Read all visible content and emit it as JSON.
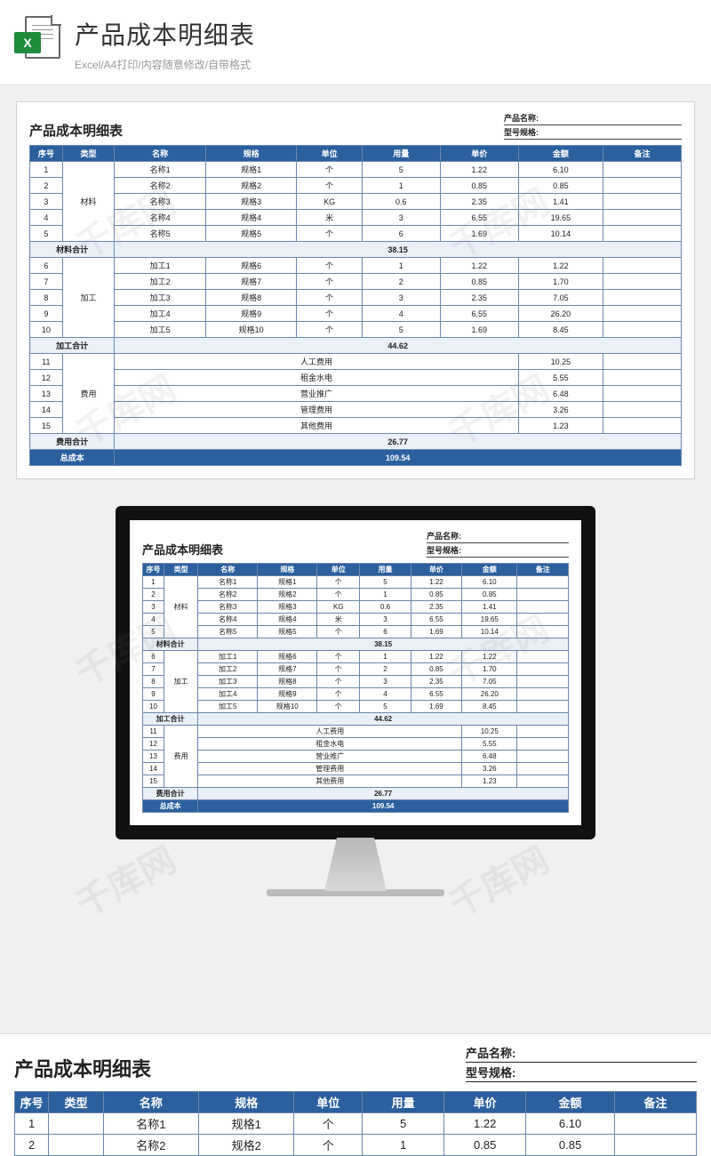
{
  "page": {
    "title": "产品成本明细表",
    "subtitle": "Excel/A4打印/内容随意修改/自带格式",
    "excel_badge": "X"
  },
  "sheet": {
    "title": "产品成本明细表",
    "meta": {
      "product_label": "产品名称:",
      "product_value": "",
      "model_label": "型号规格:",
      "model_value": ""
    },
    "columns": [
      "序号",
      "类型",
      "名称",
      "规格",
      "单位",
      "用量",
      "单价",
      "金额",
      "备注"
    ],
    "groups": [
      {
        "type": "材料",
        "rows": [
          {
            "seq": "1",
            "name": "名称1",
            "spec": "规格1",
            "unit": "个",
            "qty": "5",
            "price": "1.22",
            "amount": "6.10",
            "note": ""
          },
          {
            "seq": "2",
            "name": "名称2",
            "spec": "规格2",
            "unit": "个",
            "qty": "1",
            "price": "0.85",
            "amount": "0.85",
            "note": ""
          },
          {
            "seq": "3",
            "name": "名称3",
            "spec": "规格3",
            "unit": "KG",
            "qty": "0.6",
            "price": "2.35",
            "amount": "1.41",
            "note": ""
          },
          {
            "seq": "4",
            "name": "名称4",
            "spec": "规格4",
            "unit": "米",
            "qty": "3",
            "price": "6.55",
            "amount": "19.65",
            "note": ""
          },
          {
            "seq": "5",
            "name": "名称5",
            "spec": "规格5",
            "unit": "个",
            "qty": "6",
            "price": "1.69",
            "amount": "10.14",
            "note": ""
          }
        ],
        "subtotal_label": "材料合计",
        "subtotal_value": "38.15"
      },
      {
        "type": "加工",
        "rows": [
          {
            "seq": "6",
            "name": "加工1",
            "spec": "规格6",
            "unit": "个",
            "qty": "1",
            "price": "1.22",
            "amount": "1.22",
            "note": ""
          },
          {
            "seq": "7",
            "name": "加工2",
            "spec": "规格7",
            "unit": "个",
            "qty": "2",
            "price": "0.85",
            "amount": "1.70",
            "note": ""
          },
          {
            "seq": "8",
            "name": "加工3",
            "spec": "规格8",
            "unit": "个",
            "qty": "3",
            "price": "2.35",
            "amount": "7.05",
            "note": ""
          },
          {
            "seq": "9",
            "name": "加工4",
            "spec": "规格9",
            "unit": "个",
            "qty": "4",
            "price": "6.55",
            "amount": "26.20",
            "note": ""
          },
          {
            "seq": "10",
            "name": "加工5",
            "spec": "规格10",
            "unit": "个",
            "qty": "5",
            "price": "1.69",
            "amount": "8.45",
            "note": ""
          }
        ],
        "subtotal_label": "加工合计",
        "subtotal_value": "44.62"
      },
      {
        "type": "费用",
        "expense_rows": [
          {
            "seq": "11",
            "label": "人工费用",
            "amount": "10.25"
          },
          {
            "seq": "12",
            "label": "租金水电",
            "amount": "5.55"
          },
          {
            "seq": "13",
            "label": "营业推广",
            "amount": "6.48"
          },
          {
            "seq": "14",
            "label": "管理费用",
            "amount": "3.26"
          },
          {
            "seq": "15",
            "label": "其他费用",
            "amount": "1.23"
          }
        ],
        "subtotal_label": "费用合计",
        "subtotal_value": "26.77"
      }
    ],
    "total_label": "总成本",
    "total_value": "109.54"
  },
  "watermark": "千库网"
}
